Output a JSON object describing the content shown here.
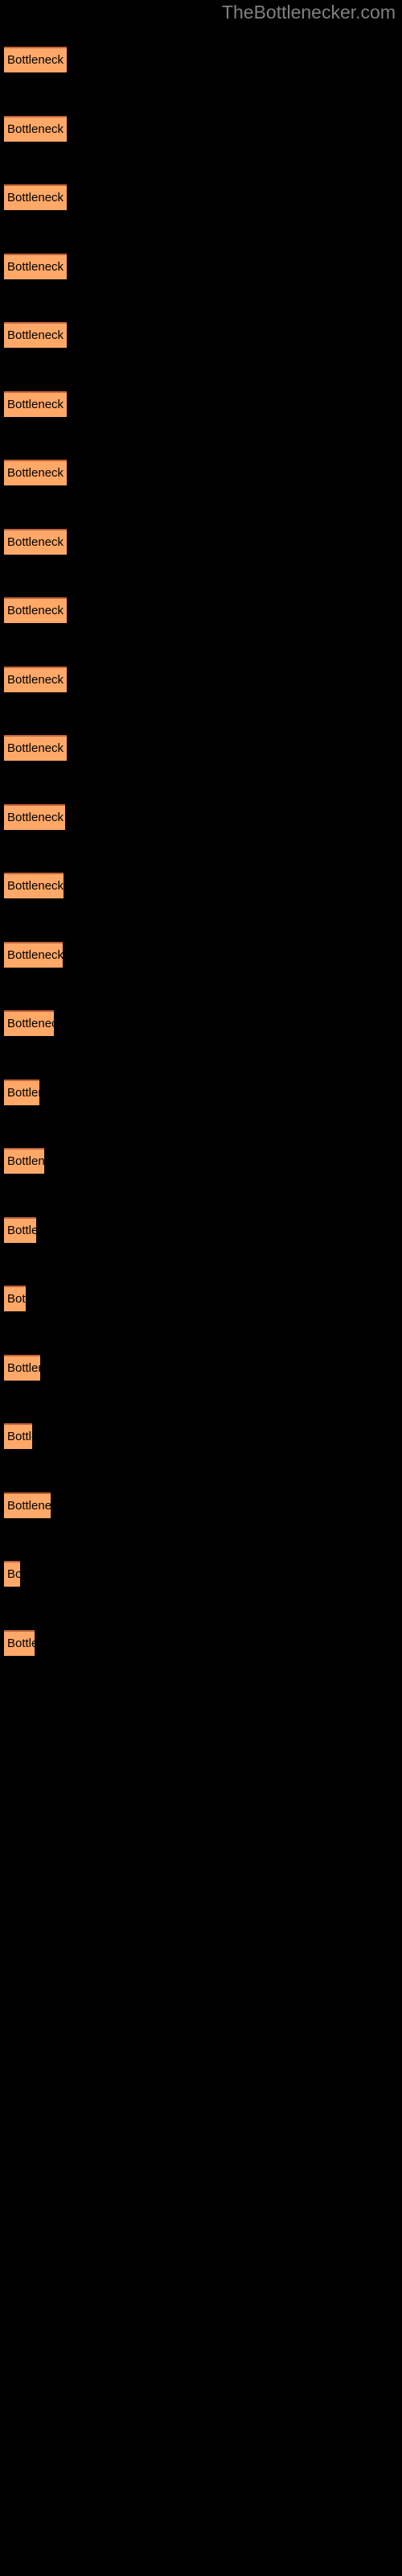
{
  "header": {
    "site_title": "TheBottlenecker.com"
  },
  "colors": {
    "background": "#000000",
    "bar_fill": "#FFA867",
    "bar_top_border": "#C1643A",
    "label_text": "#000000",
    "title_text": "#808080"
  },
  "chart_data": {
    "type": "bar",
    "orientation": "horizontal",
    "title": "TheBottlenecker.com",
    "xlabel": "",
    "ylabel": "",
    "grid": false,
    "legend": null,
    "bar_label_text": "Bottleneck result",
    "categories": [
      "Bottleneck result",
      "Bottleneck result",
      "Bottleneck result",
      "Bottleneck result",
      "Bottleneck result",
      "Bottleneck result",
      "Bottleneck result",
      "Bottleneck result",
      "Bottleneck result",
      "Bottleneck result",
      "Bottleneck result",
      "Bottleneck result",
      "Bottleneck result",
      "Bottleneck result",
      "Bottleneck result",
      "Bottleneck result",
      "Bottleneck result",
      "Bottleneck result",
      "Bottleneck result",
      "Bottleneck result",
      "Bottleneck result",
      "Bottleneck result",
      "Bottleneck result",
      "Bottleneck result"
    ],
    "values": [
      78,
      78,
      78,
      78,
      78,
      78,
      78,
      78,
      78,
      78,
      78,
      78,
      76,
      70,
      62,
      52,
      47,
      42,
      25,
      40,
      32,
      48,
      22,
      41
    ],
    "xlim": [
      0,
      495
    ]
  },
  "bars": [
    {
      "label": "Bottleneck result",
      "visible_label": "Bottleneck result",
      "top": 58,
      "width": 78
    },
    {
      "label": "Bottleneck result",
      "visible_label": "Bottleneck result",
      "top": 144,
      "width": 78
    },
    {
      "label": "Bottleneck result",
      "visible_label": "Bottleneck result",
      "top": 229,
      "width": 78
    },
    {
      "label": "Bottleneck result",
      "visible_label": "Bottleneck result",
      "top": 315,
      "width": 78
    },
    {
      "label": "Bottleneck result",
      "visible_label": "Bottleneck result",
      "top": 400,
      "width": 78
    },
    {
      "label": "Bottleneck result",
      "visible_label": "Bottleneck result",
      "top": 486,
      "width": 78
    },
    {
      "label": "Bottleneck result",
      "visible_label": "Bottleneck result",
      "top": 571,
      "width": 78
    },
    {
      "label": "Bottleneck result",
      "visible_label": "Bottleneck result",
      "top": 657,
      "width": 78
    },
    {
      "label": "Bottleneck result",
      "visible_label": "Bottleneck result",
      "top": 742,
      "width": 78
    },
    {
      "label": "Bottleneck result",
      "visible_label": "Bottleneck result",
      "top": 828,
      "width": 78
    },
    {
      "label": "Bottleneck result",
      "visible_label": "Bottleneck result",
      "top": 913,
      "width": 78
    },
    {
      "label": "Bottleneck result",
      "visible_label": "Bottleneck result",
      "top": 999,
      "width": 76
    },
    {
      "label": "Bottleneck result",
      "visible_label": "Bottleneck result",
      "top": 1084,
      "width": 74
    },
    {
      "label": "Bottleneck result",
      "visible_label": "Bottleneck result",
      "top": 1170,
      "width": 73
    },
    {
      "label": "Bottleneck result",
      "visible_label": "Bottleneck re",
      "top": 1255,
      "width": 62
    },
    {
      "label": "Bottleneck result",
      "visible_label": "Bottlene",
      "top": 1341,
      "width": 44
    },
    {
      "label": "Bottleneck result",
      "visible_label": "Bottleneck",
      "top": 1426,
      "width": 50
    },
    {
      "label": "Bottleneck result",
      "visible_label": "Bottlen",
      "top": 1512,
      "width": 40
    },
    {
      "label": "Bottleneck result",
      "visible_label": "Bo",
      "top": 1597,
      "width": 27
    },
    {
      "label": "Bottleneck result",
      "visible_label": "Bottlen",
      "top": 1683,
      "width": 45
    },
    {
      "label": "Bottleneck result",
      "visible_label": "Bottle",
      "top": 1768,
      "width": 35
    },
    {
      "label": "Bottleneck result",
      "visible_label": "Bottlenec",
      "top": 1854,
      "width": 58
    },
    {
      "label": "Bottleneck result",
      "visible_label": "Bo",
      "top": 1939,
      "width": 20
    },
    {
      "label": "Bottleneck result",
      "visible_label": "Bottle",
      "top": 2025,
      "width": 38
    }
  ]
}
